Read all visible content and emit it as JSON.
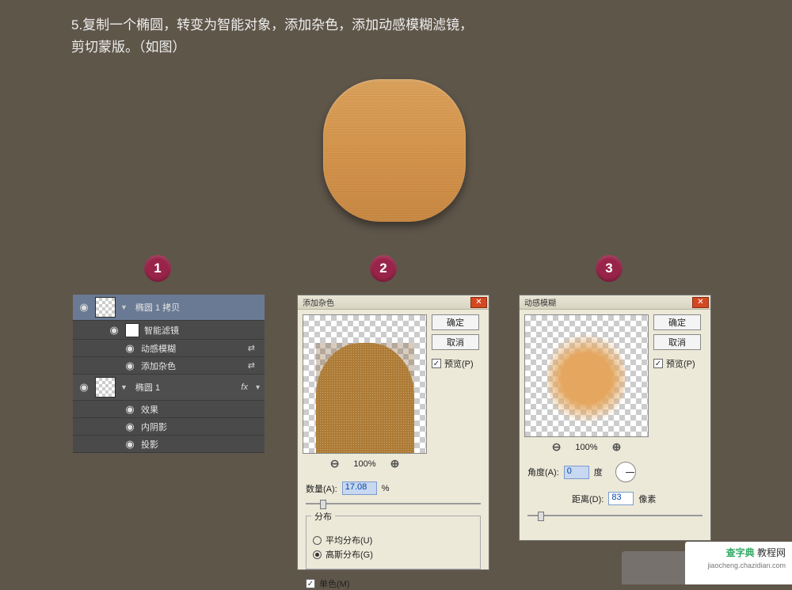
{
  "instruction": {
    "line1": "5.复制一个椭圆，转变为智能对象，添加杂色，添加动感模糊滤镜，",
    "line2": "剪切蒙版。（如图）"
  },
  "badges": {
    "b1": "1",
    "b2": "2",
    "b3": "3"
  },
  "layers": {
    "row1_name": "椭圆 1 拷贝",
    "smart_filters": "智能滤镜",
    "filter_blur": "动感模糊",
    "filter_noise": "添加杂色",
    "row2_name": "椭圆 1",
    "fx": "fx",
    "effects": "效果",
    "inner_shadow": "内阴影",
    "drop_shadow": "投影"
  },
  "noise_dialog": {
    "title": "添加杂色",
    "ok": "确定",
    "cancel": "取消",
    "preview": "预览(P)",
    "zoom": "100%",
    "amount_label": "数量(A):",
    "amount_value": "17.08",
    "amount_unit": "%",
    "dist_legend": "分布",
    "dist_uniform": "平均分布(U)",
    "dist_gaussian": "高斯分布(G)",
    "mono": "单色(M)"
  },
  "blur_dialog": {
    "title": "动感模糊",
    "ok": "确定",
    "cancel": "取消",
    "preview": "预览(P)",
    "zoom": "100%",
    "angle_label": "角度(A):",
    "angle_value": "0",
    "angle_unit": "度",
    "distance_label": "距离(D):",
    "distance_value": "83",
    "distance_unit": "像素"
  },
  "watermark": {
    "site": "查字典",
    "sub": "教程网",
    "url": "jiaocheng.chazidian.com"
  }
}
